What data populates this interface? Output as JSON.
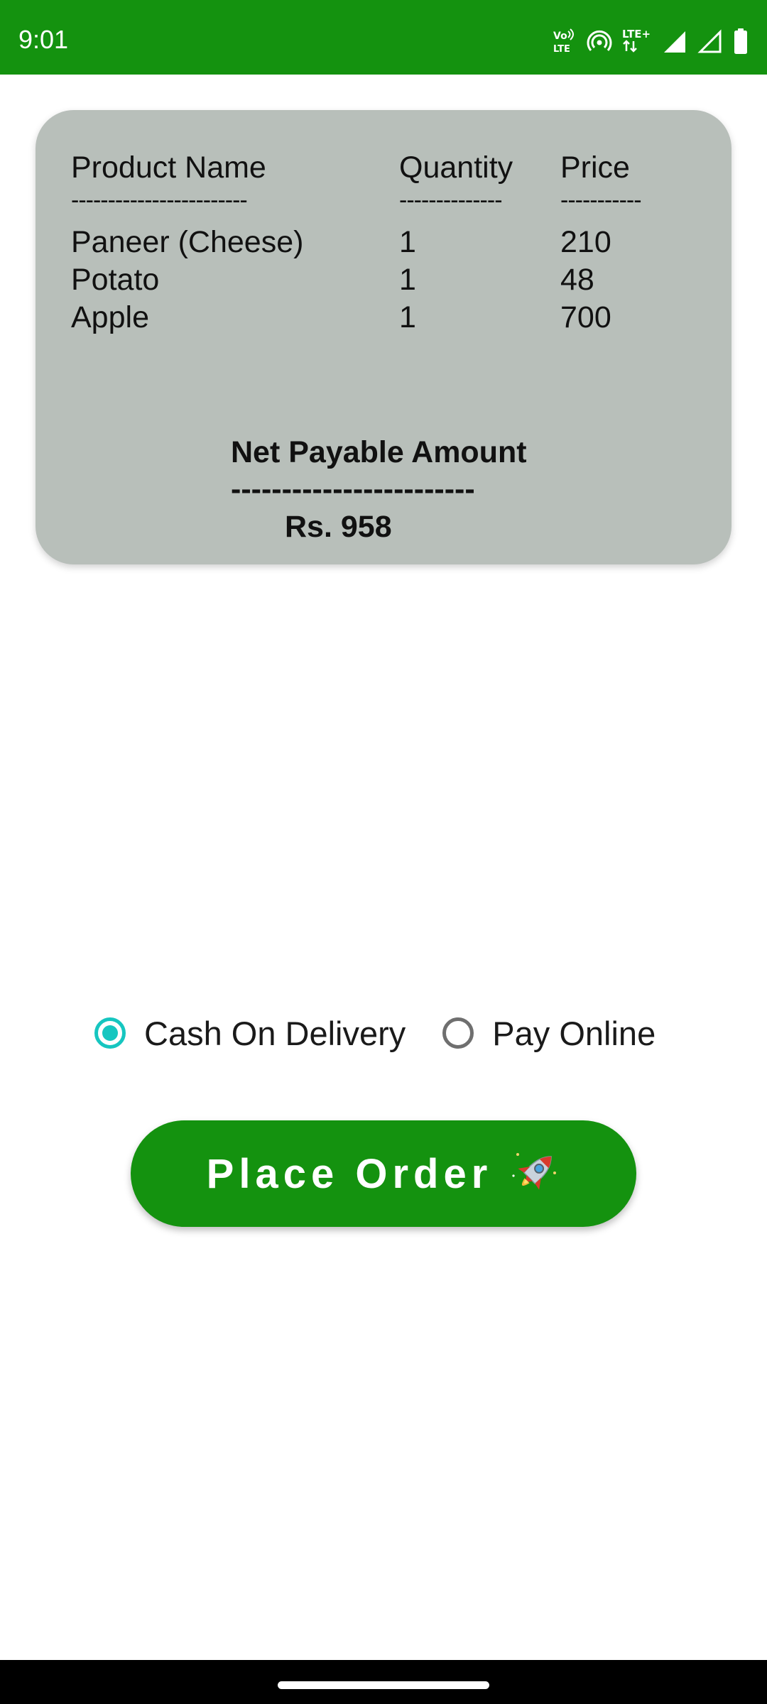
{
  "status_bar": {
    "time": "9:01",
    "icons": [
      "volte-icon",
      "hotspot-icon",
      "lte-plus-icon",
      "signal-icon",
      "signal-empty-icon",
      "battery-icon"
    ],
    "volte_text_top": "Vo",
    "volte_text_bottom": "LTE",
    "lte_text": "LTE+",
    "color": "#14920f"
  },
  "bill": {
    "headers": {
      "product": "Product Name",
      "quantity": "Quantity",
      "price": "Price"
    },
    "separators": {
      "product": "------------------------",
      "quantity": "--------------",
      "price": "-----------"
    },
    "items": [
      {
        "name": "Paneer (Cheese)",
        "quantity": "1",
        "price": "210"
      },
      {
        "name": "Potato",
        "quantity": "1",
        "price": "48"
      },
      {
        "name": "Apple",
        "quantity": "1",
        "price": "700"
      }
    ],
    "net_label": "Net Payable Amount",
    "net_separator": "------------------------",
    "net_amount": "Rs. 958",
    "card_color": "#b8bfba"
  },
  "payment": {
    "options": [
      {
        "label": "Cash On Delivery",
        "selected": true
      },
      {
        "label": "Pay Online",
        "selected": false
      }
    ],
    "accent_color": "#16c6c0"
  },
  "place_order": {
    "label": "Place Order",
    "icon": "rocket-icon",
    "color": "#14920f"
  }
}
